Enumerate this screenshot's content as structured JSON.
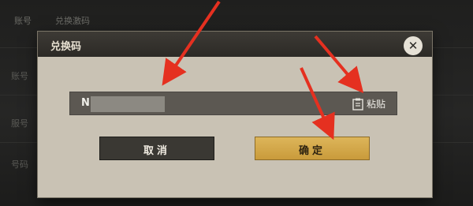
{
  "background": {
    "tab_left": "账号",
    "tab_center": "兑换激码",
    "side_labels": [
      "账号",
      "服号",
      "号码"
    ]
  },
  "dialog": {
    "title": "兑换码",
    "close_icon": "close-icon"
  },
  "input": {
    "value": "N",
    "paste_label": "粘贴",
    "paste_icon": "clipboard-icon"
  },
  "buttons": {
    "cancel_label": "取消",
    "confirm_label": "确定"
  },
  "colors": {
    "dialog_bg": "#c9c2b4",
    "header_bg": "#2c2a26",
    "input_bg": "#5c5852",
    "confirm_accent": "#ddb55a",
    "arrow": "#e53020"
  }
}
